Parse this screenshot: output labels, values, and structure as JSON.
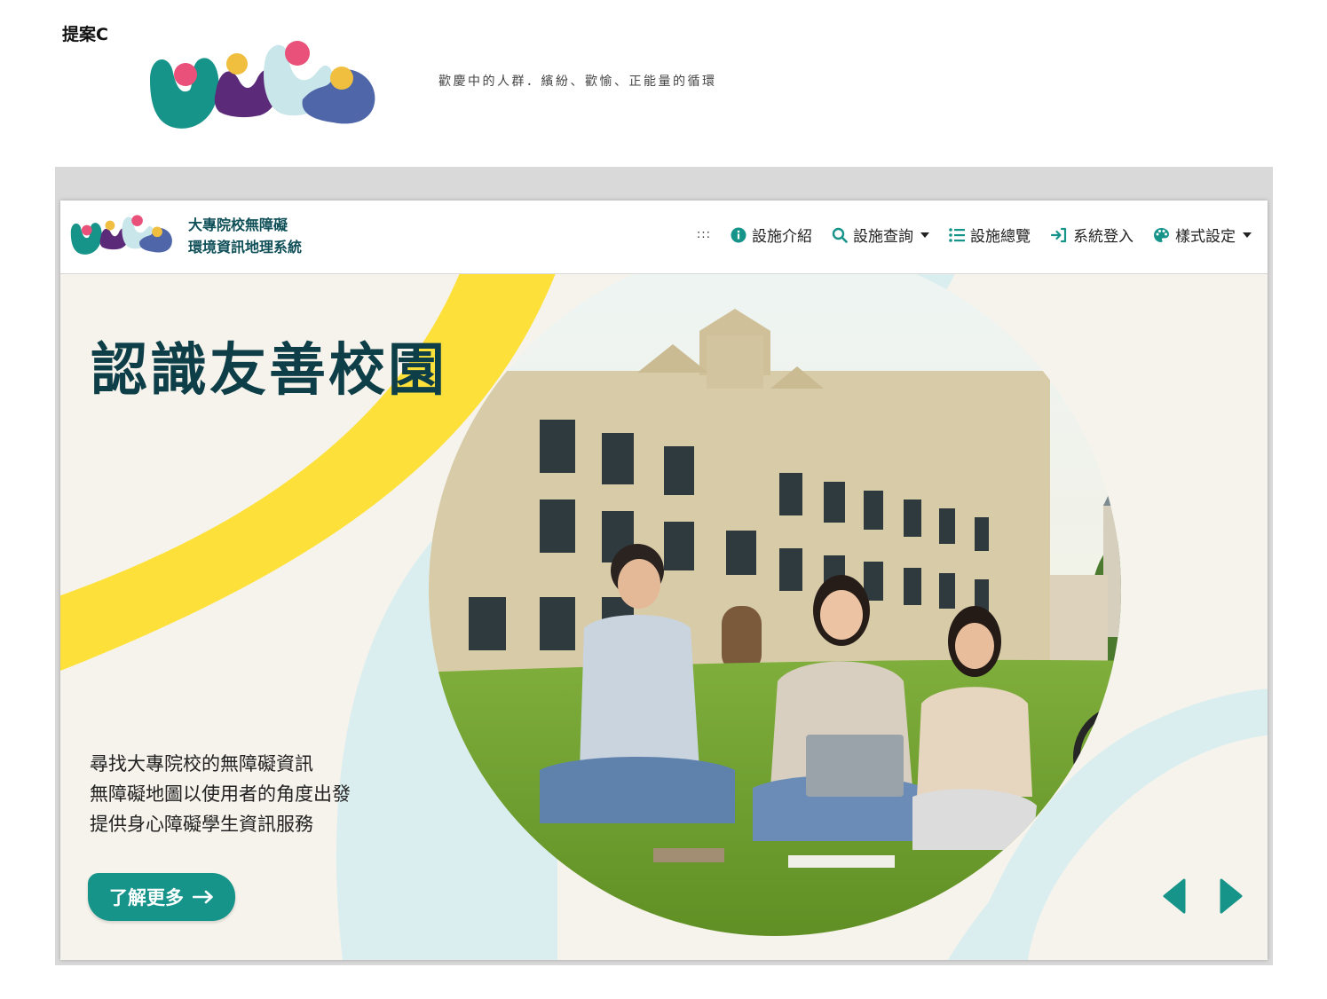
{
  "proposal": {
    "label": "提案C"
  },
  "tagline": "歡慶中的人群．繽紛、歡愉、正能量的循環",
  "site": {
    "title_line1": "大專院校無障礙",
    "title_line2": "環境資訊地理系統",
    "accesskey": ":::",
    "nav": [
      {
        "label": "設施介紹",
        "icon": "info-icon"
      },
      {
        "label": "設施查詢",
        "icon": "search-icon",
        "dropdown": true
      },
      {
        "label": "設施總覽",
        "icon": "list-icon"
      },
      {
        "label": "系統登入",
        "icon": "login-icon"
      },
      {
        "label": "樣式設定",
        "icon": "palette-icon",
        "dropdown": true
      }
    ]
  },
  "hero": {
    "title": "認識友善校園",
    "desc_lines": [
      "尋找大專院校的無障礙資訊",
      "無障礙地圖以使用者的角度出發",
      "提供身心障礙學生資訊服務"
    ],
    "button_label": "了解更多",
    "image_icon": "campus-students-photo"
  },
  "colors": {
    "teal": "#169489",
    "dark_teal": "#0e3f48",
    "yellow": "#fde13a",
    "pale_blue": "#dbeeef",
    "cream": "#f6f3ec",
    "logo_pink": "#e9507a",
    "logo_purple": "#5b2a78",
    "logo_lightblue": "#c9e6ea",
    "logo_blue": "#4f66a8",
    "logo_gold": "#f1bf3f"
  }
}
